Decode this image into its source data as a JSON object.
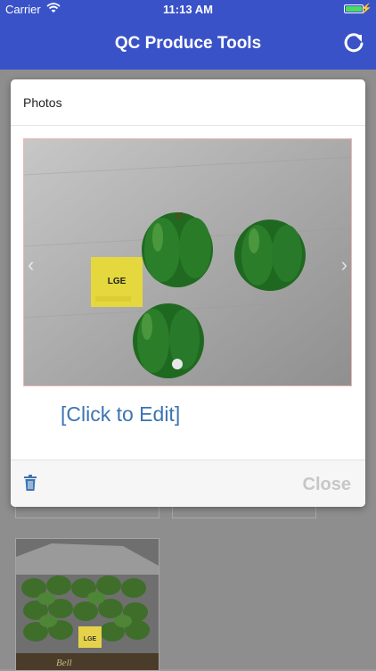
{
  "status_bar": {
    "carrier": "Carrier",
    "time": "11:13 AM",
    "battery_level": 1.0
  },
  "nav": {
    "title": "QC Produce Tools",
    "refresh_icon": "refresh-icon"
  },
  "modal": {
    "title": "Photos",
    "photo_label": "LGE",
    "edit_link": "[Click to Edit]",
    "close_label": "Close",
    "delete_icon": "trash-icon",
    "prev_icon": "chevron-left-icon",
    "next_icon": "chevron-right-icon"
  },
  "background": {
    "thumb_label": "LGE",
    "thumb_box_text": "Bell"
  },
  "colors": {
    "nav_bg": "#3a52c8",
    "link": "#3d74b3",
    "close_disabled": "#c7c7c7"
  }
}
